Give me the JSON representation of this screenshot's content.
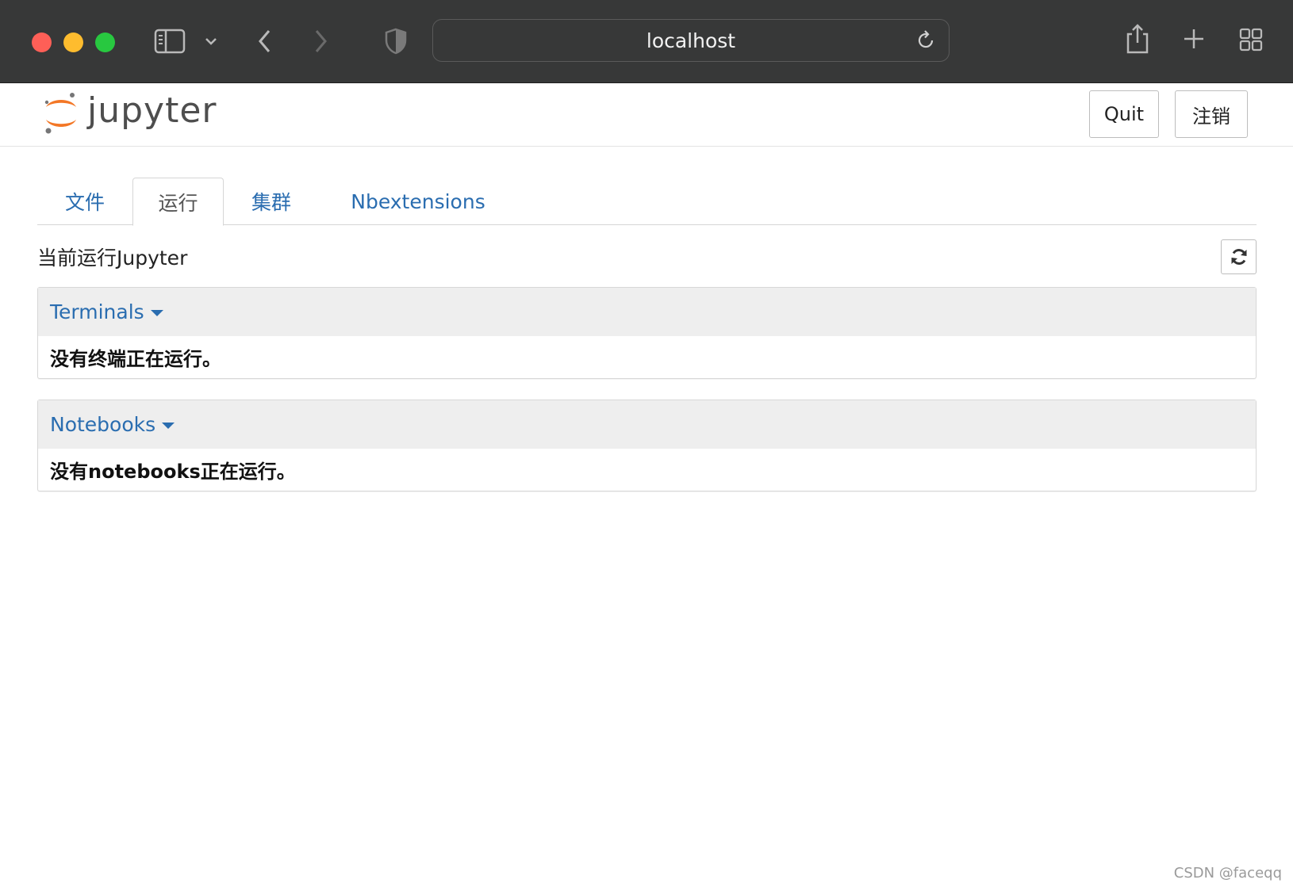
{
  "browser": {
    "url": "localhost",
    "colors": {
      "chrome_bg": "#373838",
      "close": "#fe5f57",
      "minimize": "#febc2e",
      "zoom": "#28c840"
    },
    "icons": [
      "sidebar-icon",
      "chevron-down-icon",
      "back-icon",
      "forward-icon",
      "shield-icon",
      "reload-icon",
      "share-icon",
      "new-tab-icon",
      "tab-overview-icon"
    ]
  },
  "header": {
    "logo_text": "jupyter",
    "quit_label": "Quit",
    "logout_label": "注销"
  },
  "tabs": [
    {
      "label": "文件",
      "active": false
    },
    {
      "label": "运行",
      "active": true
    },
    {
      "label": "集群",
      "active": false
    },
    {
      "label": "Nbextensions",
      "active": false
    }
  ],
  "running": {
    "title": "当前运行Jupyter",
    "refresh_icon": "refresh-icon"
  },
  "panels": [
    {
      "heading": "Terminals",
      "message": "没有终端正在运行。"
    },
    {
      "heading": "Notebooks",
      "message": "没有notebooks正在运行。"
    }
  ],
  "colors": {
    "link": "#2a6db0",
    "logo_orange": "#f37726",
    "panel_heading_bg": "#eeeeee"
  },
  "watermark": "CSDN @faceqq"
}
